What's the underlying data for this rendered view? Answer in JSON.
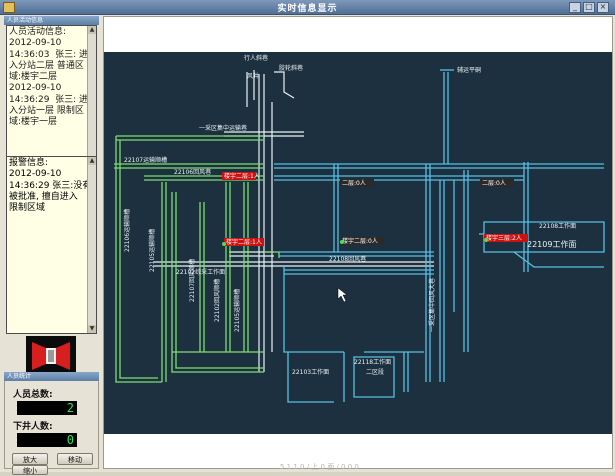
{
  "window": {
    "title": "实时信息显示"
  },
  "activity": {
    "title": "人员活动信息",
    "lines": [
      "人员活动信息:",
      "2012-09-10",
      "14:36:03  张三: 进",
      "入分站二层 普通区",
      "域:楼宇二层",
      "2012-09-10",
      "14:36:29  张三: 进",
      "入分站一层 限制区",
      "域:楼宇一层"
    ]
  },
  "alarm": {
    "lines": [
      "报警信息:",
      "2012-09-10",
      "14:36:29 张三:没有",
      "被批准, 擅自进入",
      "限制区域"
    ]
  },
  "stats": {
    "title": "人员统计",
    "total_label": "人员总数:",
    "total_value": "2",
    "underground_label": "下井人数:",
    "underground_value": "0"
  },
  "buttons": {
    "zoom_in": "放大",
    "move": "移动",
    "zoom_out": "缩小"
  },
  "map": {
    "markers": [
      {
        "label": "楼宇二层:1人"
      },
      {
        "label": "二层:0人"
      },
      {
        "label": "二层:0人"
      },
      {
        "label": "楼宇二层:1人"
      },
      {
        "label": "楼宇二层:0人"
      },
      {
        "label": "楼宇三层:2人"
      }
    ],
    "labels": [
      "行人斜巷",
      "风井",
      "胶轮斜巷",
      "辅运平硐",
      "一采区集中运输巷",
      "22107运输顺槽",
      "22106回风巷",
      "22106运输顺槽",
      "22105运输顺槽",
      "22107回风顺槽",
      "22102回风顺槽",
      "22105运输顺槽",
      "22102综采工作面",
      "22109工作面",
      "22103工作面",
      "22108工作面",
      "22118工作面",
      "二区段",
      "22108回风巷",
      "一采区集中回风大巷"
    ],
    "status": "5 1 1 0 / 上 0 面 / 0 0 0"
  },
  "colors": {
    "green_lines": "#7cdc6f",
    "cyan_lines": "#56c0e2",
    "white_lines": "#e9f2f4",
    "map_bg": "#1d3040",
    "marker_bg": "#cc1111"
  }
}
